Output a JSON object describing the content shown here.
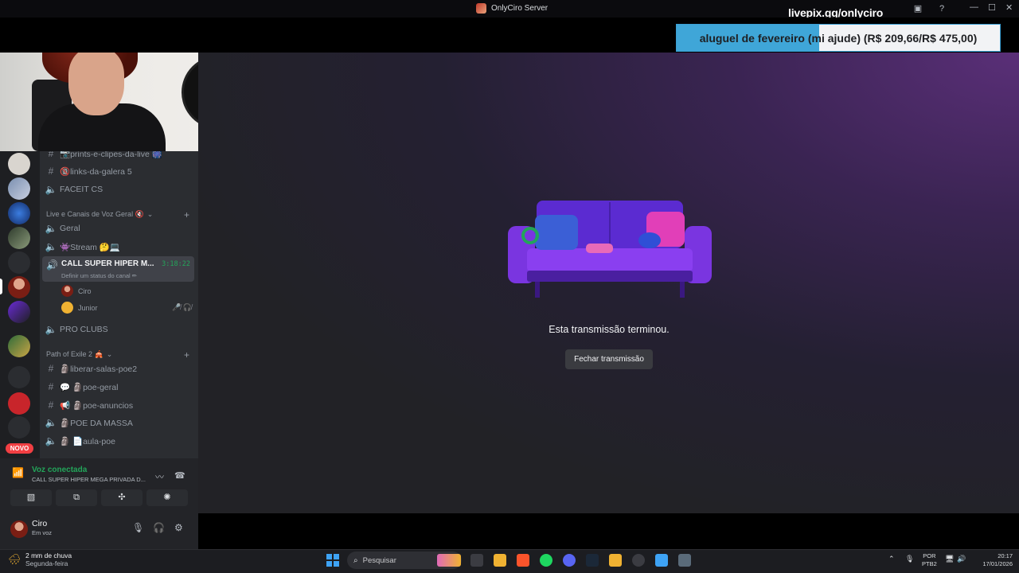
{
  "window": {
    "title": "OnlyCiro Server",
    "overlay_handle": "livepix.gg/onlyciro"
  },
  "donation": {
    "text": "aluguel de fevereiro (mi ajude) (R$ 209,66/R$ 475,00)",
    "progress_fraction": 0.4414
  },
  "channels": {
    "items": [
      {
        "type": "text",
        "label": "📷prints-e-clipes-da-live 🎆"
      },
      {
        "type": "text",
        "label": "🔞links-da-galera 5"
      },
      {
        "type": "voice",
        "label": "FACEIT CS"
      }
    ],
    "category1": "Live e Canais de Voz Geral 🔇",
    "voice1": [
      {
        "label": "Geral"
      },
      {
        "label": "👾Stream 🤔💻"
      }
    ],
    "active": {
      "name": "CALL SUPER HIPER M...",
      "time": "3:18:22",
      "status_hint": "Definir um status do canal ✏"
    },
    "users": [
      {
        "name": "Ciro"
      },
      {
        "name": "Junior"
      }
    ],
    "pro_clubs": "PRO CLUBS",
    "category2": "Path of Exile 2 🎪",
    "poe": [
      {
        "type": "text",
        "label": "🗿liberar-salas-poe2"
      },
      {
        "type": "text",
        "label": "💬 🗿poe-geral"
      },
      {
        "type": "text",
        "label": "📢 🗿poe-anuncios"
      },
      {
        "type": "voice",
        "label": "🗿POE DA MASSA"
      },
      {
        "type": "voice",
        "label": "🗿 📄aula-poe"
      }
    ]
  },
  "novo_badge": "NOVO",
  "voice_panel": {
    "title": "Voz conectada",
    "channel": "CALL SUPER HIPER MEGA PRIVADA D..."
  },
  "userbar": {
    "name": "Ciro",
    "status": "Em voz"
  },
  "stream": {
    "ended_text": "Esta transmissão terminou.",
    "close_label": "Fechar transmissão"
  },
  "taskbar": {
    "weather_line1": "2 mm de chuva",
    "weather_line2": "Segunda-feira",
    "search_placeholder": "Pesquisar",
    "lang_line1": "POR",
    "lang_line2": "PTB2",
    "time": "20:17",
    "date": "17/01/2026"
  },
  "colors": {
    "accent_green": "#23a55a",
    "donation_fill": "#3fa6d8",
    "danger": "#f23f43"
  }
}
